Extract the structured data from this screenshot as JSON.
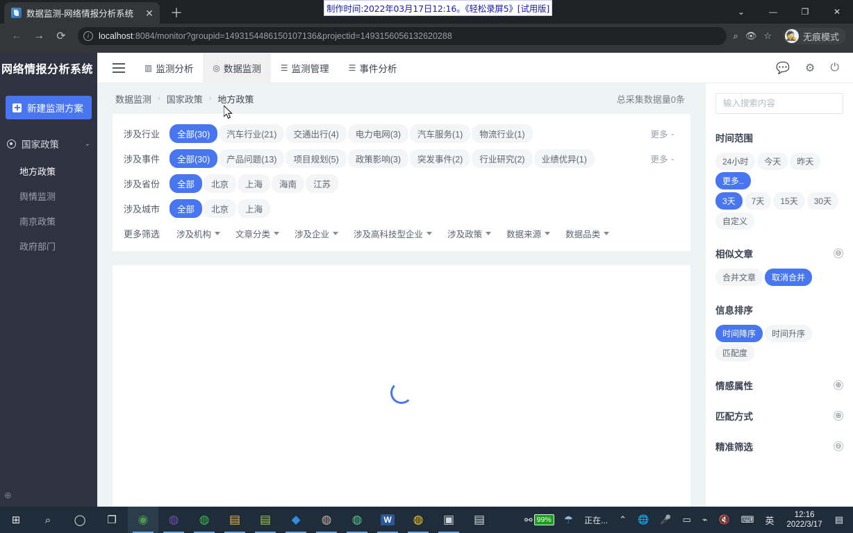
{
  "browser": {
    "tab_title": "数据监测-网络情报分析系统",
    "tab_close_glyph": "✕",
    "newtab_glyph": "＋",
    "win_minimize": "—",
    "win_maximize": "❐",
    "win_close": "✕",
    "win_chevron": "⌄",
    "back_glyph": "←",
    "forward_glyph": "→",
    "reload_glyph": "⟳",
    "info_glyph": "i",
    "url_host": "localhost",
    "url_rest": ":8084/monitor?groupid=1493154486150107136&projectid=1493156056132620288",
    "omni_search_glyph": "⌕",
    "omni_eye_glyph": "👁",
    "omni_star_glyph": "☆",
    "incognito_label": "无痕模式",
    "incognito_glyph": "🕵",
    "recorder_banner": "制作时间:2022年03月17日12:16。《轻松录屏5》[试用版]"
  },
  "app_header": {
    "brand": "网络情报分析系统",
    "menu_icon": "hamburger-icon",
    "nav": [
      {
        "label": "监测分析",
        "icon": "▥",
        "active": false
      },
      {
        "label": "数据监测",
        "icon": "◎",
        "active": true
      },
      {
        "label": "监测管理",
        "icon": "☰",
        "active": false
      },
      {
        "label": "事件分析",
        "icon": "☰",
        "active": false
      }
    ],
    "right_icons": [
      {
        "name": "chat-icon",
        "glyph": "💬"
      },
      {
        "name": "gear-icon",
        "glyph": "⚙"
      },
      {
        "name": "power-icon",
        "glyph": "⏻"
      }
    ]
  },
  "sidebar": {
    "new_plan_label": "新建监测方案",
    "group_label": "国家政策",
    "group_chevron": "⌄",
    "items": [
      {
        "label": "地方政策",
        "active": true
      },
      {
        "label": "舆情监测",
        "active": false
      },
      {
        "label": "南京政策",
        "active": false
      },
      {
        "label": "政府部门",
        "active": false
      }
    ],
    "footer_icon": "⊕"
  },
  "breadcrumb": {
    "items": [
      "数据监测",
      "国家政策",
      "地方政策"
    ],
    "separator": "›",
    "total_label": "总采集数据量0条"
  },
  "filters": {
    "more_label": "更多",
    "more_caret": "⌄",
    "rows": [
      {
        "label": "涉及行业",
        "has_more": true,
        "chips": [
          {
            "text": "全部(30)",
            "state": "on"
          },
          {
            "text": "汽车行业(21)",
            "state": "grey"
          },
          {
            "text": "交通出行(4)",
            "state": "grey"
          },
          {
            "text": "电力电网(3)",
            "state": "grey"
          },
          {
            "text": "汽车服务(1)",
            "state": "grey"
          },
          {
            "text": "物流行业(1)",
            "state": "grey"
          }
        ]
      },
      {
        "label": "涉及事件",
        "has_more": true,
        "chips": [
          {
            "text": "全部(30)",
            "state": "on"
          },
          {
            "text": "产品问题(13)",
            "state": "grey"
          },
          {
            "text": "项目规划(5)",
            "state": "grey"
          },
          {
            "text": "政策影响(3)",
            "state": "grey"
          },
          {
            "text": "突发事件(2)",
            "state": "grey"
          },
          {
            "text": "行业研究(2)",
            "state": "grey"
          },
          {
            "text": "业绩优异(1)",
            "state": "grey"
          }
        ]
      },
      {
        "label": "涉及省份",
        "has_more": false,
        "chips": [
          {
            "text": "全部",
            "state": "on"
          },
          {
            "text": "北京",
            "state": "grey"
          },
          {
            "text": "上海",
            "state": "grey"
          },
          {
            "text": "海南",
            "state": "grey"
          },
          {
            "text": "江苏",
            "state": "grey"
          }
        ]
      },
      {
        "label": "涉及城市",
        "has_more": false,
        "chips": [
          {
            "text": "全部",
            "state": "on"
          },
          {
            "text": "北京",
            "state": "grey"
          },
          {
            "text": "上海",
            "state": "grey"
          }
        ]
      }
    ],
    "more_filters_label": "更多筛选",
    "dropdowns": [
      "涉及机构",
      "文章分类",
      "涉及企业",
      "涉及高科技型企业",
      "涉及政策",
      "数据来源",
      "数据品类"
    ]
  },
  "results": {
    "loading": true
  },
  "right_panel": {
    "search_placeholder": "输入搜索内容",
    "search_value": "",
    "sections": [
      {
        "title": "时间范围",
        "toggle": null,
        "rows": [
          [
            {
              "text": "24小时",
              "state": "grey"
            },
            {
              "text": "今天",
              "state": "grey"
            },
            {
              "text": "昨天",
              "state": "grey"
            },
            {
              "text": "更多..",
              "state": "on"
            }
          ],
          [
            {
              "text": "3天",
              "state": "on"
            },
            {
              "text": "7天",
              "state": "grey"
            },
            {
              "text": "15天",
              "state": "grey"
            },
            {
              "text": "30天",
              "state": "grey"
            }
          ],
          [
            {
              "text": "自定义",
              "state": "grey"
            }
          ]
        ]
      },
      {
        "title": "相似文章",
        "toggle": "⊖",
        "rows": [
          [
            {
              "text": "合并文章",
              "state": "grey"
            },
            {
              "text": "取消合并",
              "state": "on"
            }
          ]
        ]
      },
      {
        "title": "信息排序",
        "toggle": null,
        "rows": [
          [
            {
              "text": "时间降序",
              "state": "on"
            },
            {
              "text": "时间升序",
              "state": "grey"
            },
            {
              "text": "匹配度",
              "state": "grey"
            }
          ]
        ]
      },
      {
        "title": "情感属性",
        "toggle": "⊕",
        "rows": []
      },
      {
        "title": "匹配方式",
        "toggle": "⊕",
        "rows": []
      },
      {
        "title": "精准筛选",
        "toggle": "⊖",
        "rows": []
      }
    ]
  },
  "taskbar": {
    "start_glyph": "⊞",
    "search_glyph": "⌕",
    "cortana_glyph": "◯",
    "taskview_glyph": "❐",
    "apps": [
      {
        "name": "chrome",
        "glyph": "◉",
        "selected": true
      },
      {
        "name": "browser-alt",
        "glyph": "◍",
        "selected": false
      },
      {
        "name": "wechat",
        "glyph": "◍",
        "selected": false
      },
      {
        "name": "file-explorer",
        "glyph": "▤",
        "selected": false
      },
      {
        "name": "notepad",
        "glyph": "▤",
        "selected": false
      },
      {
        "name": "dingtalk",
        "glyph": "◆",
        "selected": false
      },
      {
        "name": "photo-app",
        "glyph": "◍",
        "selected": false
      },
      {
        "name": "husky-app",
        "glyph": "◍",
        "selected": false
      },
      {
        "name": "word",
        "glyph": "W",
        "selected": false
      },
      {
        "name": "sogou",
        "glyph": "◍",
        "selected": false
      },
      {
        "name": "screen-app",
        "glyph": "▣",
        "selected": false
      },
      {
        "name": "recorder-app",
        "glyph": "▤",
        "selected": false
      }
    ],
    "battery_percent": "99%",
    "weather_glyph": "☂",
    "weather_label": "正在...",
    "tray_up_glyph": "⌃",
    "tray": [
      {
        "name": "globe-icon",
        "glyph": "🌐"
      },
      {
        "name": "microphone-icon",
        "glyph": "🎤"
      },
      {
        "name": "battery-tray-icon",
        "glyph": "▭"
      },
      {
        "name": "wifi-icon",
        "glyph": "⌁"
      },
      {
        "name": "volume-muted-icon",
        "glyph": "🔇"
      },
      {
        "name": "keyboard-icon",
        "glyph": "⌨"
      },
      {
        "name": "ime-icon",
        "glyph": "英"
      }
    ],
    "clock_time": "12:16",
    "clock_date": "2022/3/17",
    "notification_glyph": "▤"
  },
  "colors": {
    "accent": "#4876f0",
    "sidebar_bg": "#2f3241",
    "page_bg": "#eef3f4",
    "chip_grey": "#f4f5f7"
  }
}
